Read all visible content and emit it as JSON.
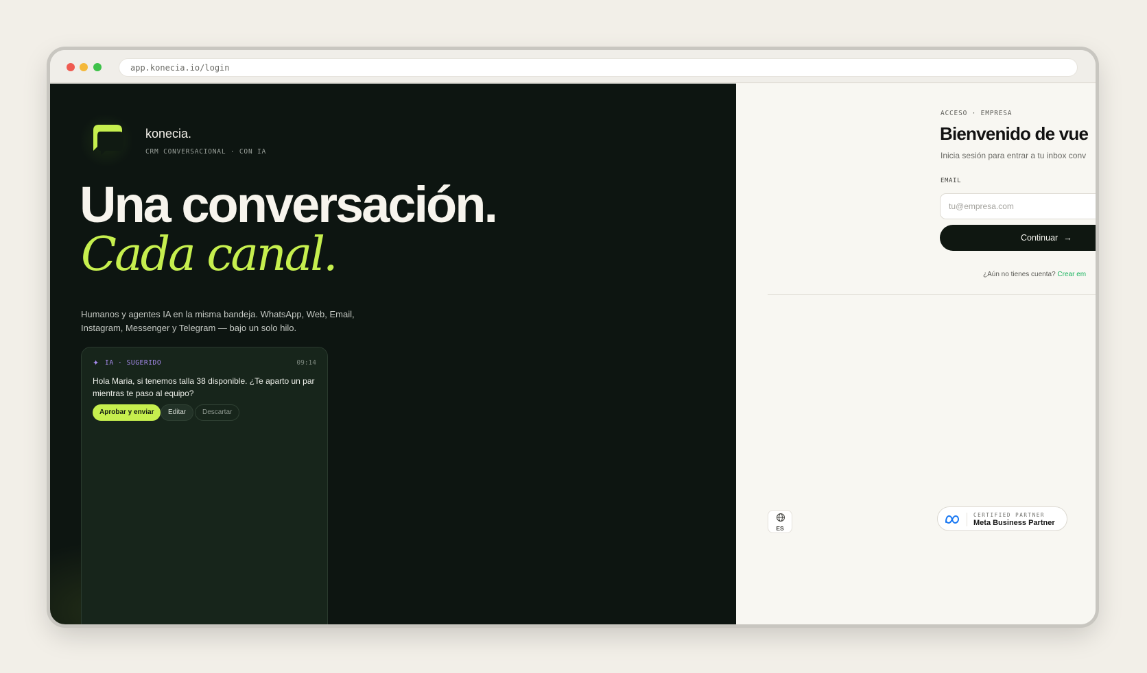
{
  "browser": {
    "url": "app.konecia.io/login"
  },
  "brand": {
    "name": "konecia.",
    "tagline": "CRM CONVERSACIONAL · CON IA",
    "accent": "#c6ef4e"
  },
  "hero": {
    "headline_1": "Una conversación.",
    "headline_2": "Cada canal.",
    "lead": "Humanos y agentes IA en la misma bandeja. WhatsApp, Web, Email, Instagram, Messenger y Telegram — bajo un solo hilo."
  },
  "suggestion_card": {
    "label": "IA · SUGERIDO",
    "time": "09:14",
    "message": "Hola Maria, si tenemos talla 38 disponible. ¿Te aparto un par mientras te paso al equipo?",
    "approve_label": "Aprobar y enviar",
    "edit_label": "Editar",
    "discard_label": "Descartar",
    "icon": "sparkle-icon"
  },
  "login": {
    "eyebrow": "ACCESO · EMPRESA",
    "title": "Bienvenido de vue",
    "subtitle": "Inicia sesión para entrar a tu inbox conv",
    "email_label": "EMAIL",
    "email_placeholder": "tu@empresa.com",
    "email_value": "",
    "continue_label": "Continuar",
    "signup_prompt": "¿Aún no tienes cuenta?",
    "signup_link": "Crear em"
  },
  "footer": {
    "language_code": "ES",
    "partner_eyebrow": "CERTIFIED PARTNER",
    "partner_title": "Meta Business Partner"
  }
}
